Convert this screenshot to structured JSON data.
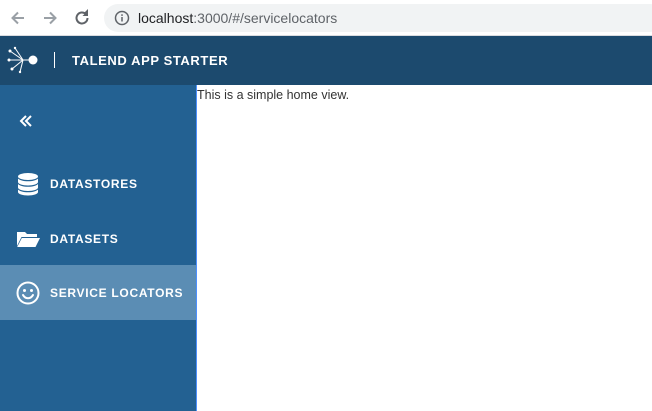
{
  "browser": {
    "url_host": "localhost",
    "url_path": ":3000/#/servicelocators"
  },
  "header": {
    "title": "TALEND APP STARTER",
    "divider": "|"
  },
  "sidebar": {
    "collapse_glyph": "«",
    "items": [
      {
        "label": "DATASTORES",
        "icon": "database-icon",
        "active": false
      },
      {
        "label": "DATASETS",
        "icon": "folder-open-icon",
        "active": false
      },
      {
        "label": "SERVICE LOCATORS",
        "icon": "smiley-icon",
        "active": true
      }
    ]
  },
  "main": {
    "text": "This is a simple home view."
  },
  "colors": {
    "header_bg": "#1c4a6e",
    "sidebar_bg": "#236192",
    "active_item_bg": "#5b8db4"
  }
}
